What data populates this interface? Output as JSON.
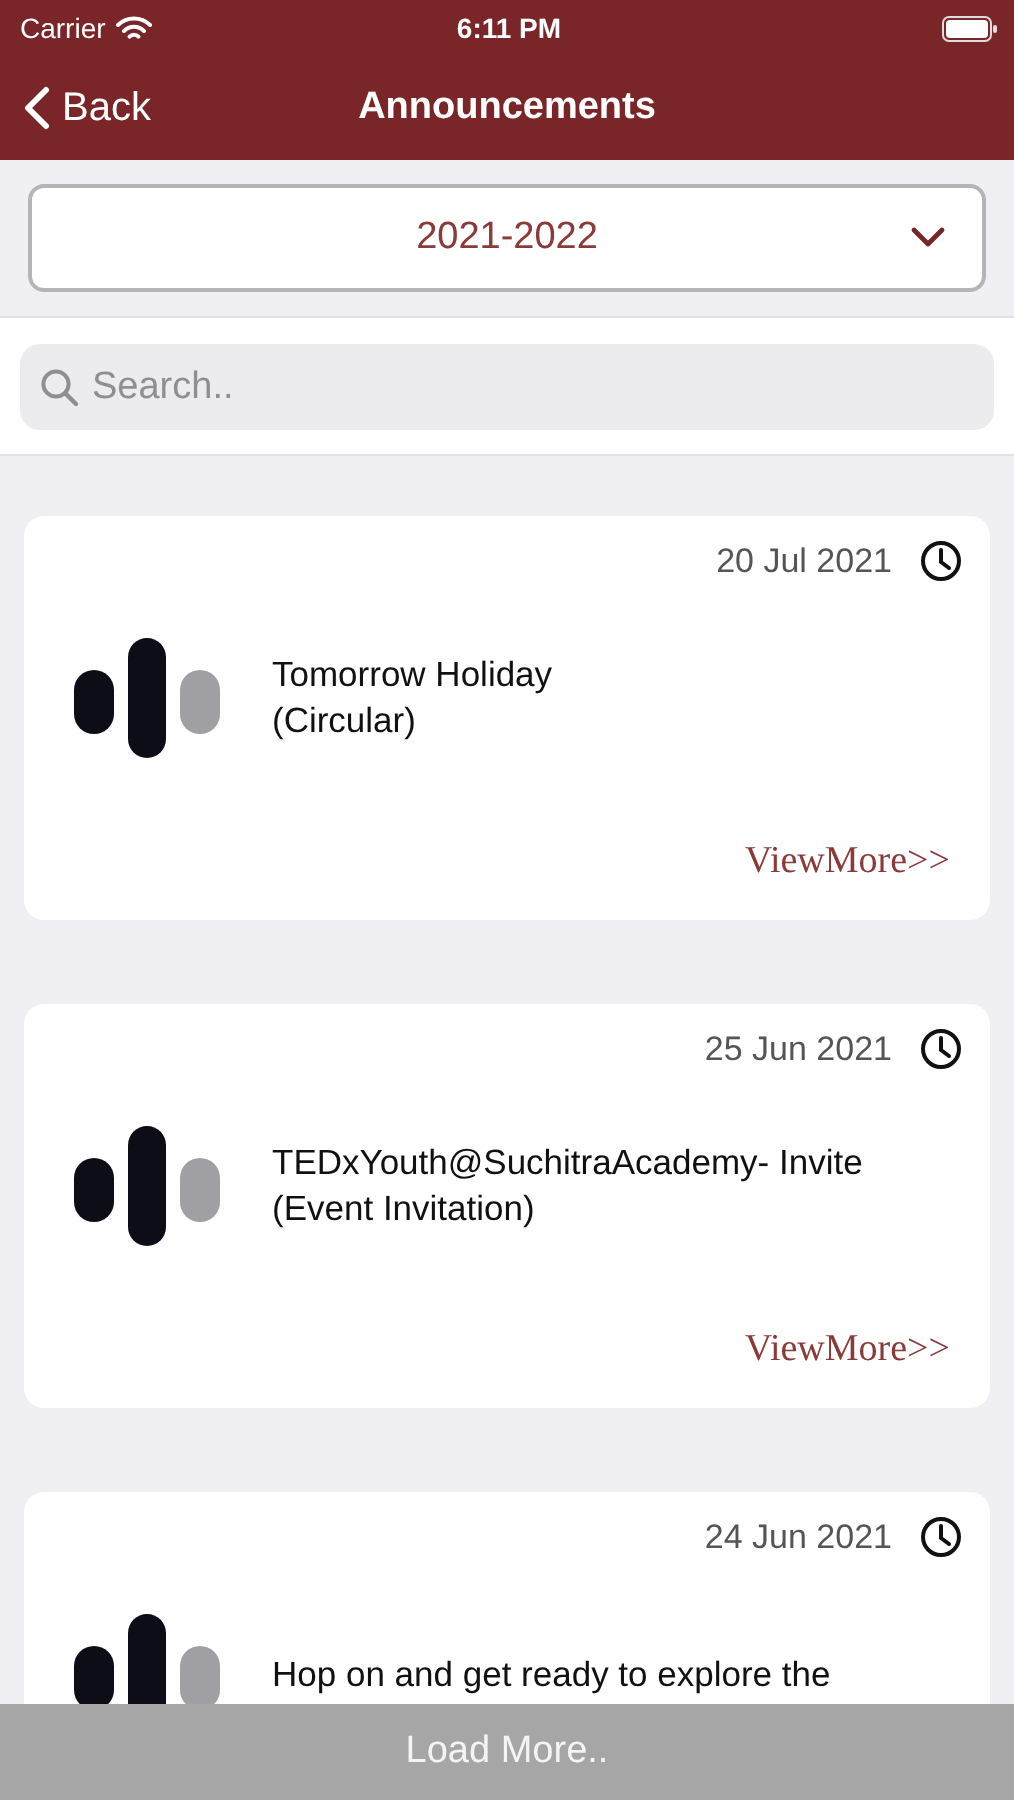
{
  "status_bar": {
    "carrier": "Carrier",
    "time": "6:11 PM"
  },
  "nav": {
    "back": "Back",
    "title": "Announcements"
  },
  "year_select": {
    "value": "2021-2022"
  },
  "search": {
    "placeholder": "Search.."
  },
  "announcements": [
    {
      "date": "20 Jul 2021",
      "title": "Tomorrow Holiday",
      "category": "(Circular)",
      "link": "ViewMore>>"
    },
    {
      "date": "25 Jun 2021",
      "title": "TEDxYouth@SuchitraAcademy- Invite",
      "category": "(Event Invitation)",
      "link": "ViewMore>>"
    },
    {
      "date": "24 Jun 2021",
      "title": "Hop on and get ready to explore the"
    }
  ],
  "load_more": "Load More.."
}
